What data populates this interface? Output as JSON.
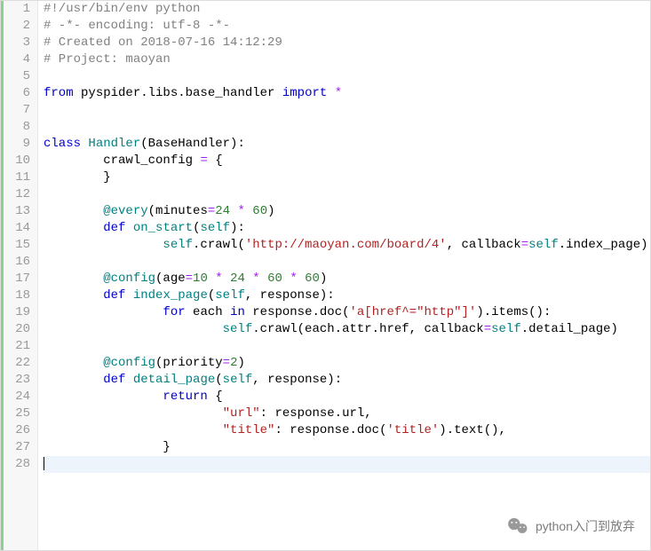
{
  "watermark_text": "python入门到放弃",
  "lines": [
    {
      "n": 1,
      "tokens": [
        [
          "c-comment",
          "#!/usr/bin/env python"
        ]
      ]
    },
    {
      "n": 2,
      "tokens": [
        [
          "c-comment",
          "# -*- encoding: utf-8 -*-"
        ]
      ]
    },
    {
      "n": 3,
      "tokens": [
        [
          "c-comment",
          "# Created on 2018-07-16 14:12:29"
        ]
      ]
    },
    {
      "n": 4,
      "tokens": [
        [
          "c-comment",
          "# Project: maoyan"
        ]
      ]
    },
    {
      "n": 5,
      "tokens": []
    },
    {
      "n": 6,
      "tokens": [
        [
          "c-keyword",
          "from"
        ],
        [
          "",
          " pyspider.libs.base_handler "
        ],
        [
          "c-keyword",
          "import"
        ],
        [
          "",
          " "
        ],
        [
          "c-op",
          "*"
        ]
      ]
    },
    {
      "n": 7,
      "tokens": []
    },
    {
      "n": 8,
      "tokens": []
    },
    {
      "n": 9,
      "tokens": [
        [
          "c-keyword",
          "class"
        ],
        [
          "",
          " "
        ],
        [
          "c-func",
          "Handler"
        ],
        [
          "",
          "(BaseHandler):"
        ]
      ]
    },
    {
      "n": 10,
      "tokens": [
        [
          "",
          "        crawl_config "
        ],
        [
          "c-op",
          "="
        ],
        [
          "",
          " {"
        ]
      ]
    },
    {
      "n": 11,
      "tokens": [
        [
          "",
          "        }"
        ]
      ]
    },
    {
      "n": 12,
      "tokens": []
    },
    {
      "n": 13,
      "tokens": [
        [
          "",
          "        "
        ],
        [
          "c-deco",
          "@every"
        ],
        [
          "",
          "(minutes"
        ],
        [
          "c-op",
          "="
        ],
        [
          "c-number",
          "24"
        ],
        [
          "",
          " "
        ],
        [
          "c-op",
          "*"
        ],
        [
          "",
          " "
        ],
        [
          "c-number",
          "60"
        ],
        [
          "",
          ")"
        ]
      ]
    },
    {
      "n": 14,
      "tokens": [
        [
          "",
          "        "
        ],
        [
          "c-keyword",
          "def"
        ],
        [
          "",
          " "
        ],
        [
          "c-func",
          "on_start"
        ],
        [
          "",
          "("
        ],
        [
          "c-self",
          "self"
        ],
        [
          "",
          "):"
        ]
      ]
    },
    {
      "n": 15,
      "tokens": [
        [
          "",
          "                "
        ],
        [
          "c-self",
          "self"
        ],
        [
          "",
          ".crawl("
        ],
        [
          "c-string",
          "'http://maoyan.com/board/4'"
        ],
        [
          "",
          ", callback"
        ],
        [
          "c-op",
          "="
        ],
        [
          "c-self",
          "self"
        ],
        [
          "",
          ".index_page)"
        ]
      ]
    },
    {
      "n": 16,
      "tokens": []
    },
    {
      "n": 17,
      "tokens": [
        [
          "",
          "        "
        ],
        [
          "c-deco",
          "@config"
        ],
        [
          "",
          "(age"
        ],
        [
          "c-op",
          "="
        ],
        [
          "c-number",
          "10"
        ],
        [
          "",
          " "
        ],
        [
          "c-op",
          "*"
        ],
        [
          "",
          " "
        ],
        [
          "c-number",
          "24"
        ],
        [
          "",
          " "
        ],
        [
          "c-op",
          "*"
        ],
        [
          "",
          " "
        ],
        [
          "c-number",
          "60"
        ],
        [
          "",
          " "
        ],
        [
          "c-op",
          "*"
        ],
        [
          "",
          " "
        ],
        [
          "c-number",
          "60"
        ],
        [
          "",
          ")"
        ]
      ]
    },
    {
      "n": 18,
      "tokens": [
        [
          "",
          "        "
        ],
        [
          "c-keyword",
          "def"
        ],
        [
          "",
          " "
        ],
        [
          "c-func",
          "index_page"
        ],
        [
          "",
          "("
        ],
        [
          "c-self",
          "self"
        ],
        [
          "",
          ", response):"
        ]
      ]
    },
    {
      "n": 19,
      "tokens": [
        [
          "",
          "                "
        ],
        [
          "c-keyword",
          "for"
        ],
        [
          "",
          " each "
        ],
        [
          "c-keyword",
          "in"
        ],
        [
          "",
          " response.doc("
        ],
        [
          "c-string",
          "'a[href^=\"http\"]'"
        ],
        [
          "",
          ").items():"
        ]
      ]
    },
    {
      "n": 20,
      "tokens": [
        [
          "",
          "                        "
        ],
        [
          "c-self",
          "self"
        ],
        [
          "",
          ".crawl(each.attr.href, callback"
        ],
        [
          "c-op",
          "="
        ],
        [
          "c-self",
          "self"
        ],
        [
          "",
          ".detail_page)"
        ]
      ]
    },
    {
      "n": 21,
      "tokens": []
    },
    {
      "n": 22,
      "tokens": [
        [
          "",
          "        "
        ],
        [
          "c-deco",
          "@config"
        ],
        [
          "",
          "(priority"
        ],
        [
          "c-op",
          "="
        ],
        [
          "c-number",
          "2"
        ],
        [
          "",
          ")"
        ]
      ]
    },
    {
      "n": 23,
      "tokens": [
        [
          "",
          "        "
        ],
        [
          "c-keyword",
          "def"
        ],
        [
          "",
          " "
        ],
        [
          "c-func",
          "detail_page"
        ],
        [
          "",
          "("
        ],
        [
          "c-self",
          "self"
        ],
        [
          "",
          ", response):"
        ]
      ]
    },
    {
      "n": 24,
      "tokens": [
        [
          "",
          "                "
        ],
        [
          "c-keyword",
          "return"
        ],
        [
          "",
          " {"
        ]
      ]
    },
    {
      "n": 25,
      "tokens": [
        [
          "",
          "                        "
        ],
        [
          "c-string",
          "\"url\""
        ],
        [
          "",
          ": response.url,"
        ]
      ]
    },
    {
      "n": 26,
      "tokens": [
        [
          "",
          "                        "
        ],
        [
          "c-string",
          "\"title\""
        ],
        [
          "",
          ": response.doc("
        ],
        [
          "c-string",
          "'title'"
        ],
        [
          "",
          ").text(),"
        ]
      ]
    },
    {
      "n": 27,
      "tokens": [
        [
          "",
          "                }"
        ]
      ]
    },
    {
      "n": 28,
      "tokens": [],
      "current": true
    }
  ]
}
